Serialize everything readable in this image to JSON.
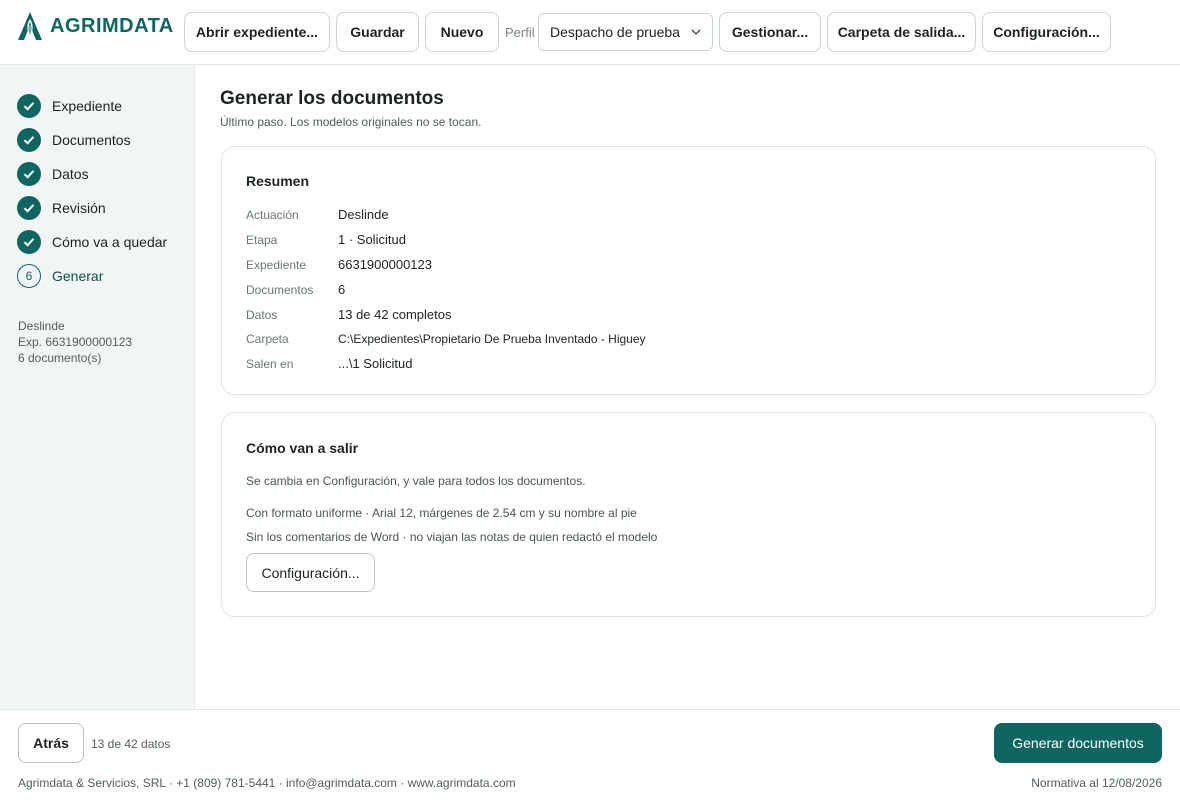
{
  "brand": {
    "name": "AGRIMDATA",
    "accent": "#0f6660"
  },
  "toolbar": {
    "open_label": "Abrir expediente...",
    "save_label": "Guardar",
    "new_label": "Nuevo",
    "profile_label": "Perfil",
    "profile_value": "Despacho de prueba",
    "manage_label": "Gestionar...",
    "output_folder_label": "Carpeta de salida...",
    "settings_label": "Configuración..."
  },
  "steps": [
    {
      "label": "Expediente",
      "status": "done",
      "icon": "check-icon"
    },
    {
      "label": "Documentos",
      "status": "done",
      "icon": "check-icon"
    },
    {
      "label": "Datos",
      "status": "done",
      "icon": "check-icon"
    },
    {
      "label": "Revisión",
      "status": "done",
      "icon": "check-icon"
    },
    {
      "label": "Cómo va a quedar",
      "status": "done",
      "icon": "check-icon"
    },
    {
      "label": "Generar",
      "status": "current",
      "number": "6"
    }
  ],
  "sidebar_info": {
    "line1": "Deslinde",
    "line2": "Exp. 6631900000123",
    "line3": "6 documento(s)"
  },
  "main": {
    "title": "Generar los documentos",
    "subtitle": "Último paso. Los modelos originales no se tocan."
  },
  "summary": {
    "title": "Resumen",
    "rows": [
      {
        "key": "Actuación",
        "value": "Deslinde"
      },
      {
        "key": "Etapa",
        "value": "1 · Solicitud"
      },
      {
        "key": "Expediente",
        "value": "6631900000123"
      },
      {
        "key": "Documentos",
        "value": "6"
      },
      {
        "key": "Datos",
        "value": "13 de 42 completos"
      },
      {
        "key": "Carpeta",
        "value": "C:\\Expedientes\\Propietario De Prueba Inventado - Higuey"
      },
      {
        "key": "Salen en",
        "value": "...\\1 Solicitud"
      }
    ]
  },
  "output": {
    "title": "Cómo van a salir",
    "note": "Se cambia en Configuración, y vale para todos los documentos.",
    "line1": "Con formato uniforme · Arial 12, márgenes de 2.54 cm y su nombre al pie",
    "line2": "Sin los comentarios de Word · no viajan las notas de quien redactó el modelo",
    "settings_label": "Configuración..."
  },
  "footer": {
    "back_label": "Atrás",
    "progress": "13 de 42 datos",
    "generate_label": "Generar documentos",
    "company": "Agrimdata & Servicios, SRL · +1 (809) 781-5441 · info@agrimdata.com · www.agrimdata.com",
    "normativa": "Normativa al 12/08/2026"
  }
}
